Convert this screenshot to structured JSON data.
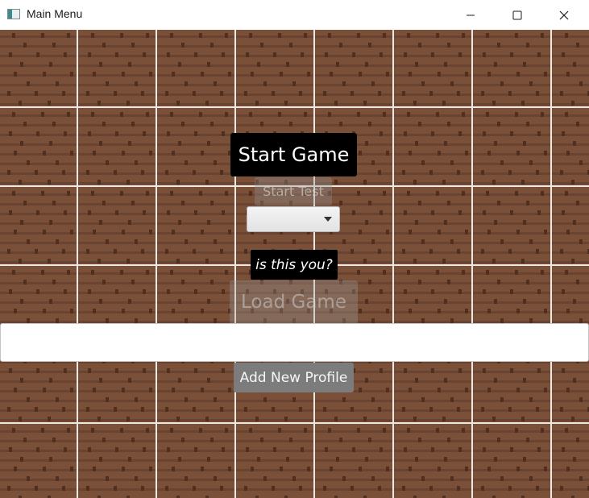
{
  "window": {
    "title": "Main Menu",
    "app_icon": "app-window-icon",
    "controls": [
      "minimize-icon",
      "maximize-icon",
      "close-icon"
    ]
  },
  "menu": {
    "start_game_label": "Start Game",
    "start_test_label": "Start Test",
    "profile_dropdown": {
      "selected": ""
    },
    "profile_prompt": "is this you?",
    "load_game_label": "Load Game",
    "profile_name_input": {
      "value": "",
      "placeholder": ""
    },
    "add_profile_label": "Add New Profile"
  },
  "colors": {
    "brick": "#7a5039",
    "mortar": "#ece9e4",
    "button_dark": "#000000",
    "button_gray": "#7c7c7c"
  }
}
